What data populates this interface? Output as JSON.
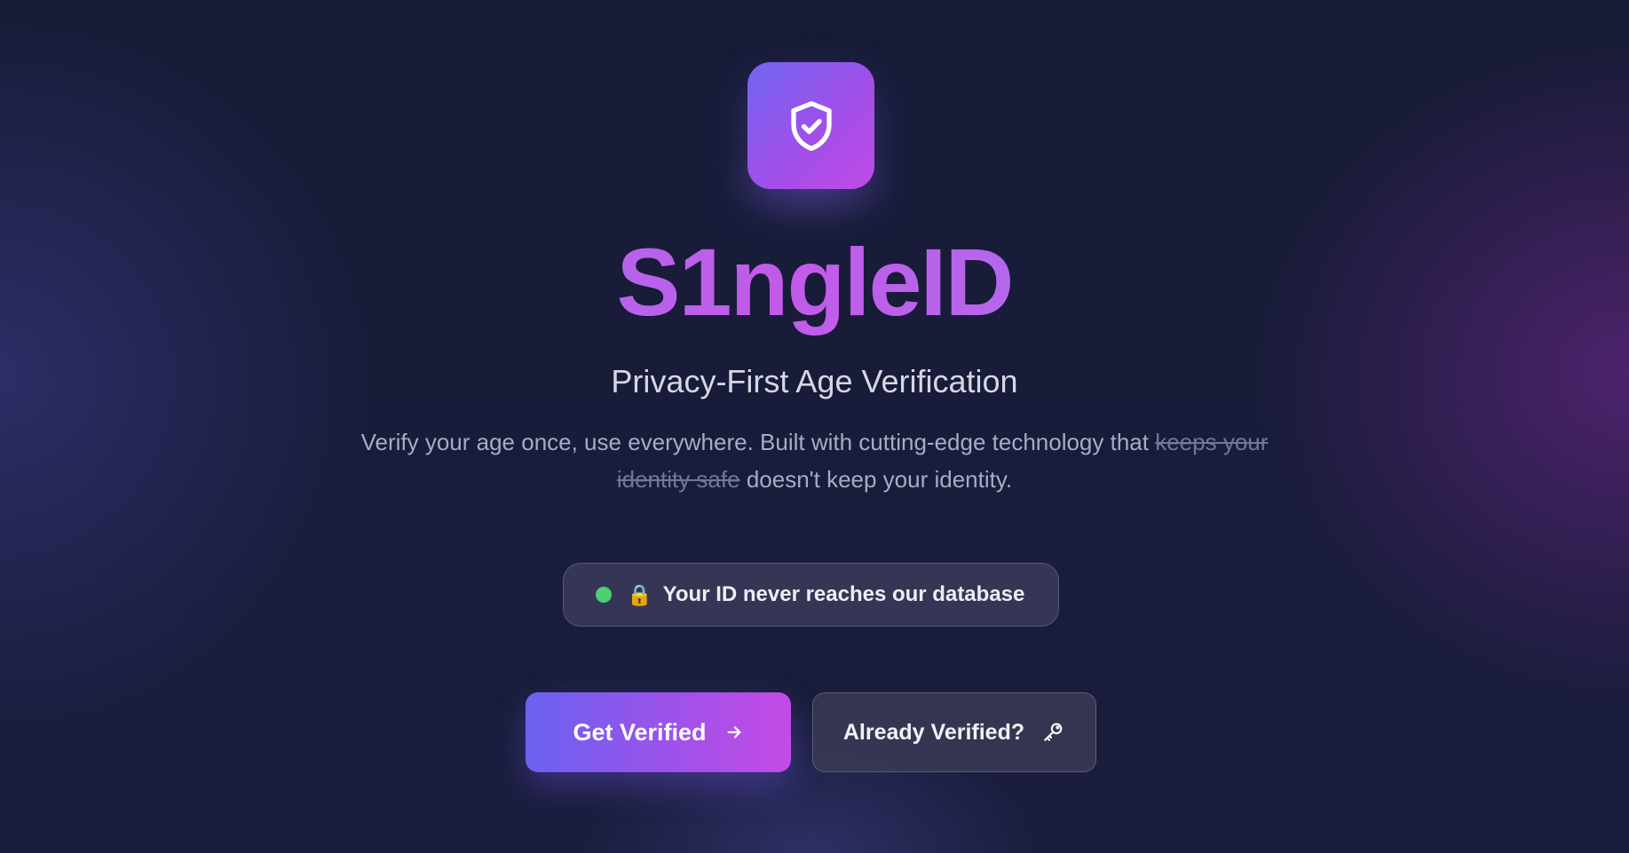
{
  "brand": {
    "name": "S1ngleID",
    "logo_icon": "shield-check-icon"
  },
  "hero": {
    "subtitle": "Privacy-First Age Verification",
    "description_lead": "Verify your age once, use everywhere. Built with cutting-edge technology that",
    "description_struck": "keeps your identity safe",
    "description_tail": "doesn't keep your identity."
  },
  "badge": {
    "status_color": "#4cce73",
    "lock_glyph": "🔒",
    "text": "Your ID never reaches our database"
  },
  "actions": {
    "primary_label": "Get Verified",
    "primary_icon": "arrow-right-icon",
    "secondary_label": "Already Verified?",
    "secondary_icon": "key-icon"
  },
  "colors": {
    "accent_start": "#6a62f0",
    "accent_end": "#c54ae6",
    "background": "#161a35"
  }
}
